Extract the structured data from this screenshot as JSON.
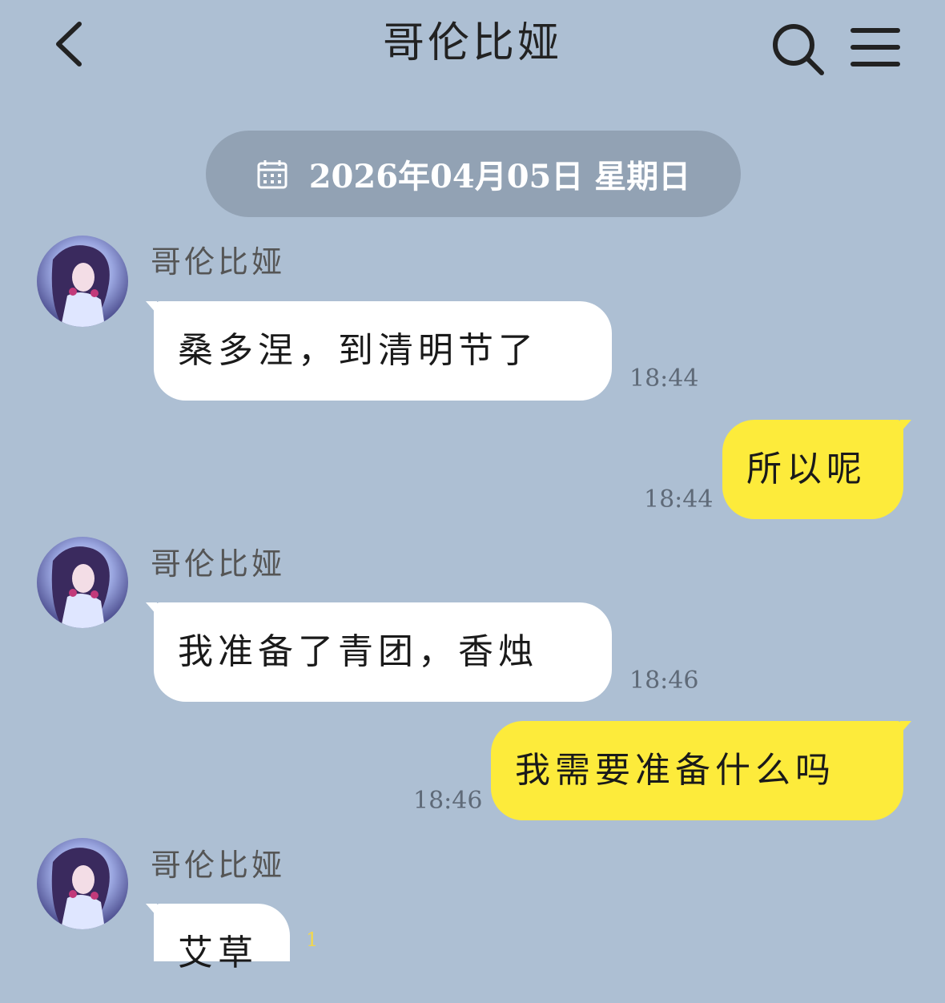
{
  "header": {
    "title": "哥伦比娅",
    "back_icon": "chevron-left-icon",
    "search_icon": "search-icon",
    "menu_icon": "menu-icon"
  },
  "date_divider": {
    "icon": "calendar-icon",
    "text": "2026年04月05日 星期日"
  },
  "messages": [
    {
      "side": "in",
      "sender": "哥伦比娅",
      "text": "桑多涅，到清明节了",
      "time": "18:44"
    },
    {
      "side": "out",
      "text": "所以呢",
      "time": "18:44"
    },
    {
      "side": "in",
      "sender": "哥伦比娅",
      "text": "我准备了青团，香烛",
      "time": "18:46"
    },
    {
      "side": "out",
      "text": "我需要准备什么吗",
      "time": "18:46"
    },
    {
      "side": "in",
      "sender": "哥伦比娅",
      "text": "艾草",
      "time": "",
      "badge": "1"
    }
  ],
  "colors": {
    "background": "#adbfd3",
    "incoming_bubble": "#ffffff",
    "outgoing_bubble": "#fdeb3b",
    "date_pill": "#92a2b4"
  }
}
